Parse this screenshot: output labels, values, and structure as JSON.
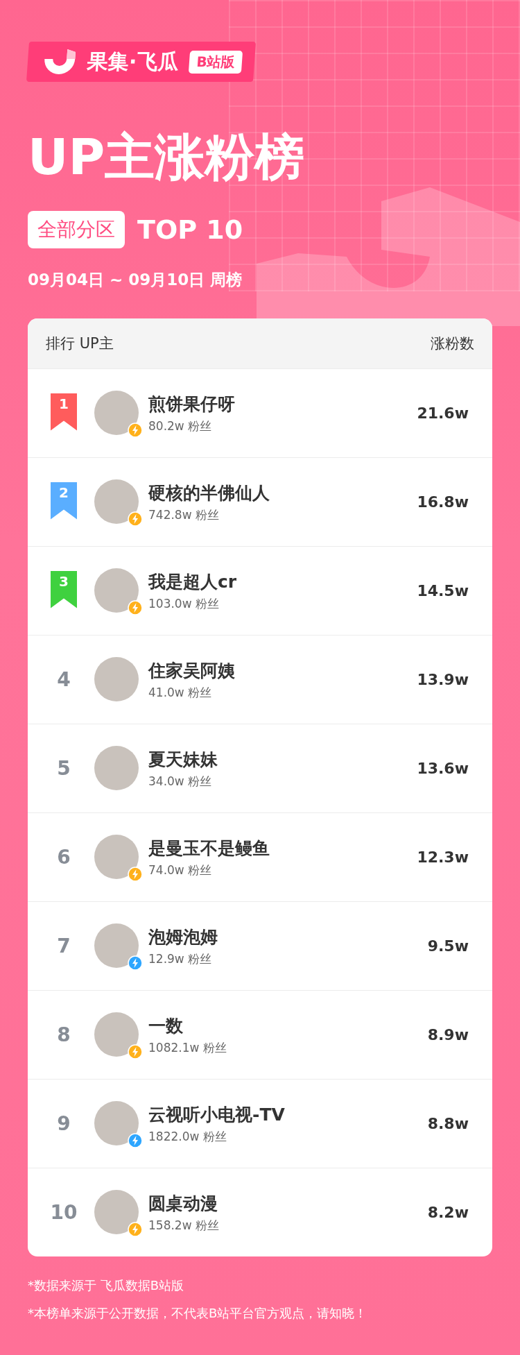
{
  "brand": {
    "name": "果集·飞瓜",
    "edition": "B站版"
  },
  "title": "UP主涨粉榜",
  "category": "全部分区",
  "top_label": "TOP 10",
  "period": "09月04日 ~ 09月10日 周榜",
  "table": {
    "columns": [
      "排行 UP主",
      "涨粉数"
    ],
    "rows": [
      {
        "rank": "1",
        "kind": "ribbon",
        "color": "#ff5c5c",
        "name": "煎饼果仔呀",
        "followers": "80.2w 粉丝",
        "gain": "21.6w",
        "badge": {
          "color": "#ffb11b"
        }
      },
      {
        "rank": "2",
        "kind": "ribbon",
        "color": "#5aaeff",
        "name": "硬核的半佛仙人",
        "followers": "742.8w 粉丝",
        "gain": "16.8w",
        "badge": {
          "color": "#ffb11b"
        }
      },
      {
        "rank": "3",
        "kind": "ribbon",
        "color": "#3fd13f",
        "name": "我是超人cr",
        "followers": "103.0w 粉丝",
        "gain": "14.5w",
        "badge": {
          "color": "#ffb11b"
        }
      },
      {
        "rank": "4",
        "kind": "plain",
        "name": "住家吴阿姨",
        "followers": "41.0w 粉丝",
        "gain": "13.9w"
      },
      {
        "rank": "5",
        "kind": "plain",
        "name": "夏天妹妹",
        "followers": "34.0w 粉丝",
        "gain": "13.6w"
      },
      {
        "rank": "6",
        "kind": "plain",
        "name": "是曼玉不是鳗鱼",
        "followers": "74.0w 粉丝",
        "gain": "12.3w",
        "badge": {
          "color": "#ffb11b"
        }
      },
      {
        "rank": "7",
        "kind": "plain",
        "name": "泡姆泡姆",
        "followers": "12.9w 粉丝",
        "gain": "9.5w",
        "badge": {
          "color": "#2ea6ff"
        }
      },
      {
        "rank": "8",
        "kind": "plain",
        "name": "一数",
        "followers": "1082.1w 粉丝",
        "gain": "8.9w",
        "badge": {
          "color": "#ffb11b"
        }
      },
      {
        "rank": "9",
        "kind": "plain",
        "name": "云视听小电视-TV",
        "followers": "1822.0w 粉丝",
        "gain": "8.8w",
        "badge": {
          "color": "#2ea6ff"
        }
      },
      {
        "rank": "10",
        "kind": "plain",
        "name": "圆桌动漫",
        "followers": "158.2w 粉丝",
        "gain": "8.2w",
        "badge": {
          "color": "#ffb11b"
        }
      }
    ]
  },
  "footnotes": [
    "*数据来源于 飞瓜数据B站版",
    "*本榜单来源于公开数据，不代表B站平台官方观点，请知晓！"
  ]
}
